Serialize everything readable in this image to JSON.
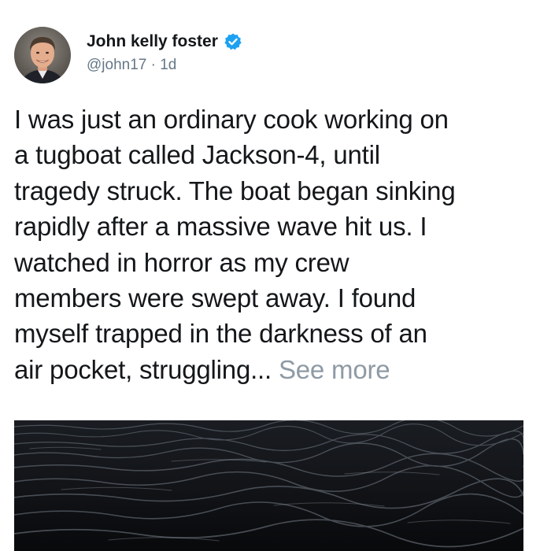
{
  "tweet": {
    "author": {
      "display_name": "John kelly foster",
      "handle": "@john17",
      "verified_icon": "verified-badge-icon",
      "avatar": "profile-avatar"
    },
    "separator": "·",
    "timestamp": "1d",
    "text_lines": [
      "I was just an ordinary cook working on",
      "a tugboat called Jackson-4, until",
      "tragedy struck. The boat began sinking",
      "rapidly after a massive wave hit us. I",
      "watched in horror as my crew",
      "members were swept away. I found",
      "myself trapped in the darkness of an",
      "air pocket, struggling..."
    ],
    "see_more_label": "See more",
    "media": {
      "type": "image",
      "subject": "dark-ocean-water"
    }
  },
  "colors": {
    "name": "#14171a",
    "secondary": "#657786",
    "see_more": "#8e9aa4",
    "verified": "#1da1f2",
    "water_dark": "#0d0f12"
  }
}
